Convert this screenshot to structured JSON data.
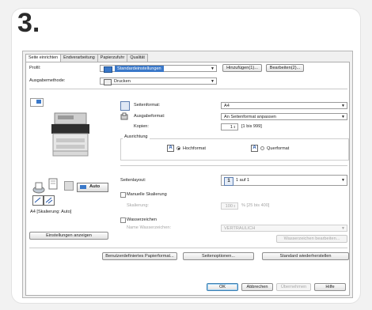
{
  "step": "3.",
  "tabs": [
    "Seite einrichten",
    "Endverarbeitung",
    "Papierzufuhr",
    "Qualität"
  ],
  "profile": {
    "label": "Profil:",
    "value": "Standardeinstellungen",
    "add_btn": "Hinzufügen(1)...",
    "edit_btn": "Bearbeiten(2)..."
  },
  "output": {
    "label": "Ausgabemethode:",
    "value": "Drucken"
  },
  "preview": {
    "auto_label": "Auto",
    "caption": "A4 [Skalierung: Auto]",
    "settings_btn": "Einstellungen anzeigen"
  },
  "page_size": {
    "label": "Seitenformat:",
    "value": "A4"
  },
  "output_size": {
    "label": "Ausgabeformat:",
    "value": "An Seitenformat anpassen"
  },
  "copies": {
    "label": "Kopien:",
    "value": "1",
    "range": "[1 bis 999]"
  },
  "orientation": {
    "label": "Ausrichtung",
    "portrait": "Hochformat",
    "landscape": "Querformat",
    "icon_letter": "A"
  },
  "layout": {
    "label": "Seitenlayout:",
    "value": "1 auf 1",
    "icon_number": "1"
  },
  "scaling": {
    "manual_label": "Manuelle Skalierung",
    "label": "Skalierung:",
    "value": "100",
    "unit": "% [25 bis 400]"
  },
  "watermark": {
    "label": "Wasserzeichen",
    "name_label": "Name Wasserzeichen:",
    "value": "VERTRAULICH",
    "edit_btn": "Wasserzeichen bearbeiten..."
  },
  "bottom_buttons": {
    "custom_paper": "Benutzerdefiniertes Papierformat...",
    "page_options": "Seitenoptionen...",
    "restore": "Standard wiederherstellen"
  },
  "dialog_buttons": {
    "ok": "OK",
    "cancel": "Abbrechen",
    "apply": "Übernehmen",
    "help": "Hilfe"
  }
}
